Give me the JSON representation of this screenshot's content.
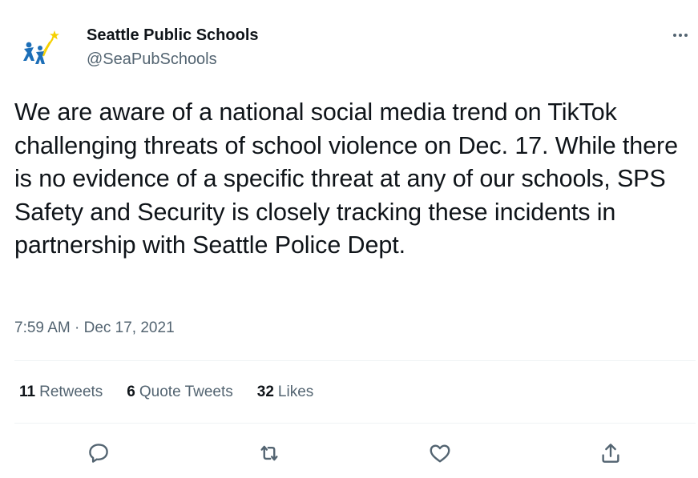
{
  "author": {
    "display_name": "Seattle Public Schools",
    "handle": "@SeaPubSchools",
    "avatar_icon": "seattle-public-schools-logo"
  },
  "more_icon": "more-options-icon",
  "tweet": {
    "text": "We are aware of a national social media trend on TikTok challenging threats of school violence on Dec. 17. While there is no evidence of a specific threat at any of our schools, SPS Safety and Security is closely tracking these incidents in partnership with Seattle Police Dept.",
    "time": "7:59 AM",
    "separator": "·",
    "date": "Dec 17, 2021"
  },
  "stats": {
    "retweets_count": "11",
    "retweets_label": "Retweets",
    "quotes_count": "6",
    "quotes_label": "Quote Tweets",
    "likes_count": "32",
    "likes_label": "Likes"
  },
  "actions": {
    "reply_icon": "reply-icon",
    "retweet_icon": "retweet-icon",
    "like_icon": "like-icon",
    "share_icon": "share-icon"
  },
  "colors": {
    "text_primary": "#0f1419",
    "text_secondary": "#536471",
    "divider": "#eff3f4",
    "logo_blue": "#1d6fb8",
    "logo_yellow": "#f5d000"
  }
}
